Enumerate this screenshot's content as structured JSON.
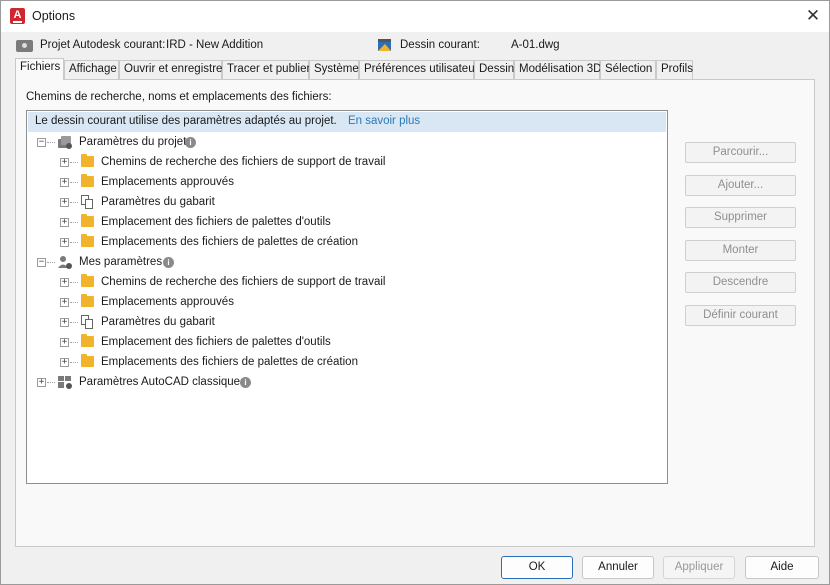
{
  "window": {
    "title": "Options",
    "close_glyph": "✕"
  },
  "profile": {
    "project_label": "Projet Autodesk courant:",
    "project_value": "IRD - New Addition",
    "drawing_label": "Dessin courant:",
    "drawing_value": "A-01.dwg"
  },
  "tabs": [
    "Fichiers",
    "Affichage",
    "Ouvrir et enregistrer",
    "Tracer et publier",
    "Système",
    "Préférences utilisateur",
    "Dessin",
    "Modélisation 3D",
    "Sélection",
    "Profils"
  ],
  "active_tab": "Fichiers",
  "panel": {
    "section_label": "Chemins de recherche, noms et emplacements des fichiers:",
    "banner_text": "Le dessin courant utilise des paramètres adaptés au projet.",
    "banner_link": "En savoir plus"
  },
  "tree": {
    "project_group": {
      "label": "Paramètres du projet",
      "children": [
        "Chemins de recherche des fichiers de support de travail",
        "Emplacements approuvés",
        "Paramètres du gabarit",
        "Emplacement des fichiers de palettes d'outils",
        "Emplacements des fichiers de palettes de création"
      ]
    },
    "my_group": {
      "label": "Mes paramètres",
      "children": [
        "Chemins de recherche des fichiers de support de travail",
        "Emplacements approuvés",
        "Paramètres du gabarit",
        "Emplacement des fichiers de palettes d'outils",
        "Emplacements des fichiers de palettes de création"
      ]
    },
    "classic_group": {
      "label": "Paramètres AutoCAD classiques"
    }
  },
  "side_buttons": {
    "browse": "Parcourir...",
    "add": "Ajouter...",
    "remove": "Supprimer",
    "move_up": "Monter",
    "move_down": "Descendre",
    "set_current": "Définir courant"
  },
  "bottom_buttons": {
    "ok": "OK",
    "cancel": "Annuler",
    "apply": "Appliquer",
    "help": "Aide"
  },
  "colors": {
    "accent": "#2a6fb8",
    "banner": "#d8e7f3",
    "folder": "#f2b32c",
    "link": "#2a7ab8"
  }
}
